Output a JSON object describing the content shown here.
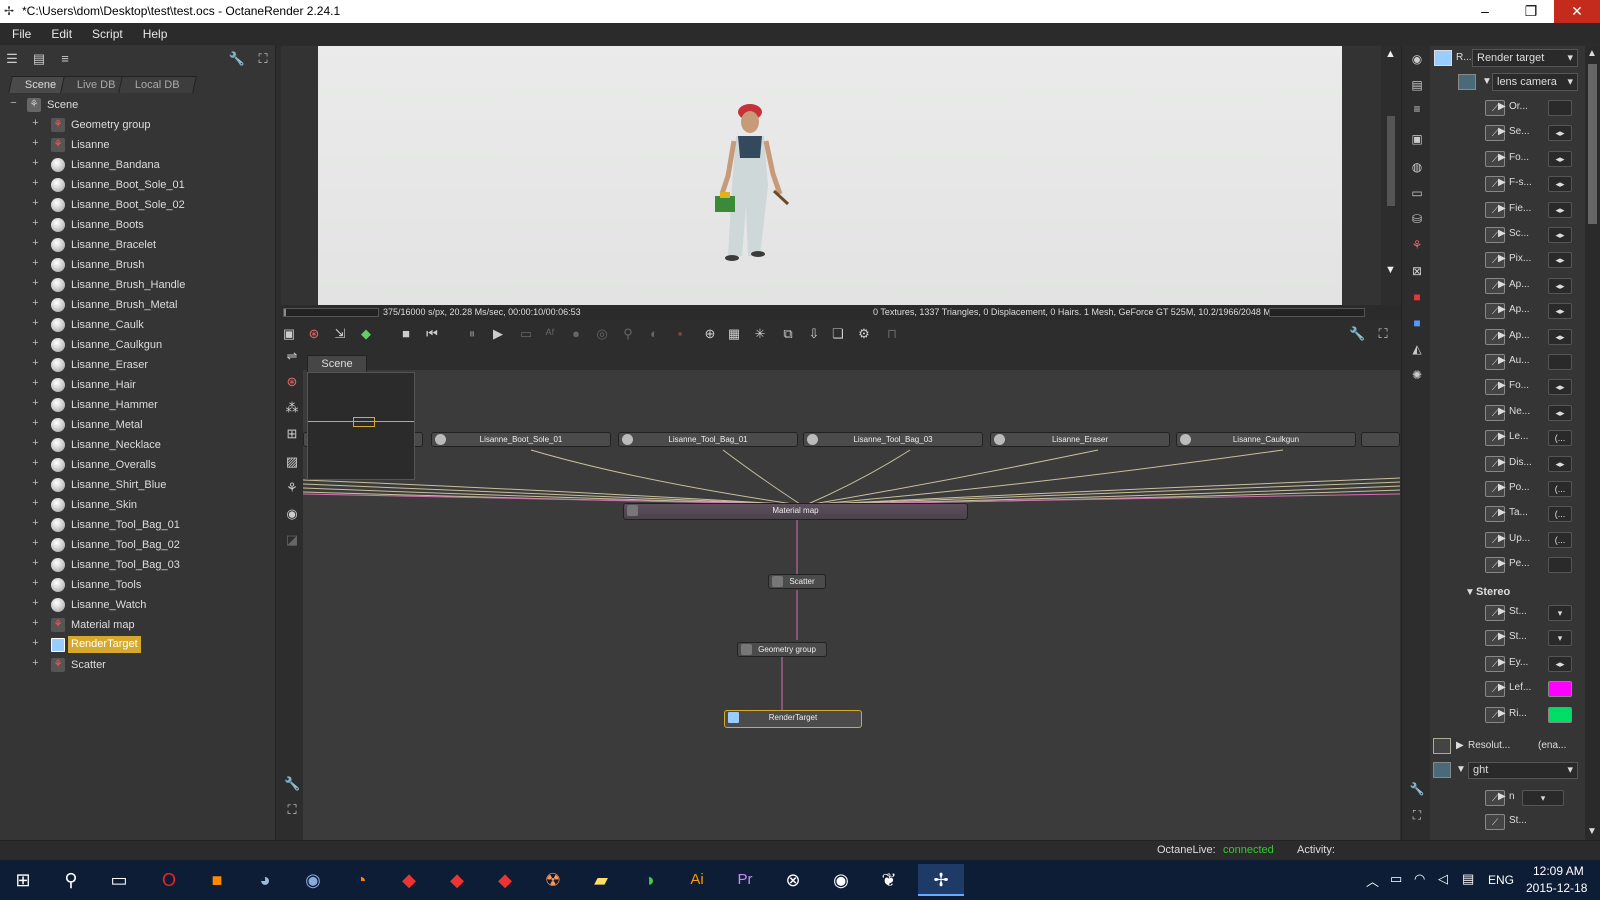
{
  "window": {
    "title": "*C:\\Users\\dom\\Desktop\\test\\test.ocs - OctaneRender 2.24.1"
  },
  "menu": [
    "File",
    "Edit",
    "Script",
    "Help"
  ],
  "left_panel": {
    "tabs": [
      "Scene",
      "Live DB",
      "Local DB"
    ],
    "root": "Scene",
    "items": [
      {
        "label": "Geometry group",
        "icon": "group-icon"
      },
      {
        "label": "Lisanne",
        "icon": "group-icon"
      },
      {
        "label": "Lisanne_Bandana",
        "icon": "material-ball-icon"
      },
      {
        "label": "Lisanne_Boot_Sole_01",
        "icon": "material-ball-icon"
      },
      {
        "label": "Lisanne_Boot_Sole_02",
        "icon": "material-ball-icon"
      },
      {
        "label": "Lisanne_Boots",
        "icon": "material-ball-icon"
      },
      {
        "label": "Lisanne_Bracelet",
        "icon": "material-ball-icon"
      },
      {
        "label": "Lisanne_Brush",
        "icon": "material-ball-icon"
      },
      {
        "label": "Lisanne_Brush_Handle",
        "icon": "material-ball-icon"
      },
      {
        "label": "Lisanne_Brush_Metal",
        "icon": "material-ball-icon"
      },
      {
        "label": "Lisanne_Caulk",
        "icon": "material-ball-icon"
      },
      {
        "label": "Lisanne_Caulkgun",
        "icon": "material-ball-icon"
      },
      {
        "label": "Lisanne_Eraser",
        "icon": "material-ball-icon"
      },
      {
        "label": "Lisanne_Hair",
        "icon": "material-ball-icon"
      },
      {
        "label": "Lisanne_Hammer",
        "icon": "material-ball-icon"
      },
      {
        "label": "Lisanne_Metal",
        "icon": "material-ball-icon"
      },
      {
        "label": "Lisanne_Necklace",
        "icon": "material-ball-icon"
      },
      {
        "label": "Lisanne_Overalls",
        "icon": "material-ball-icon"
      },
      {
        "label": "Lisanne_Shirt_Blue",
        "icon": "material-ball-icon"
      },
      {
        "label": "Lisanne_Skin",
        "icon": "material-ball-icon"
      },
      {
        "label": "Lisanne_Tool_Bag_01",
        "icon": "material-ball-icon"
      },
      {
        "label": "Lisanne_Tool_Bag_02",
        "icon": "material-ball-icon"
      },
      {
        "label": "Lisanne_Tool_Bag_03",
        "icon": "material-ball-icon"
      },
      {
        "label": "Lisanne_Tools",
        "icon": "material-ball-icon"
      },
      {
        "label": "Lisanne_Watch",
        "icon": "material-ball-icon"
      },
      {
        "label": "Material map",
        "icon": "group-icon"
      },
      {
        "label": "RenderTarget",
        "icon": "render-target-icon",
        "selected": true
      },
      {
        "label": "Scatter",
        "icon": "group-icon"
      }
    ]
  },
  "viewport": {
    "stats_left": "375/16000 s/px, 20.28 Ms/sec, 00:00:10/00:06:53",
    "stats_right": "0 Textures, 1337 Triangles, 0 Displacement, 0 Hairs. 1 Mesh, GeForce GT 525M, 10.2/1966/2048 MB"
  },
  "graph": {
    "tab": "Scene",
    "top_nodes": [
      "Lisanne_Boot_Sole_01",
      "Lisanne_Tool_Bag_01",
      "Lisanne_Tool_Bag_03",
      "Lisanne_Eraser",
      "Lisanne_Caulkgun"
    ],
    "material_map": "Material map",
    "scatter": "Scatter",
    "geometry_group": "Geometry group",
    "render_target": "RenderTarget"
  },
  "props": {
    "header": "R...",
    "header_select": "Render target",
    "camera_select": "lens camera",
    "rows": [
      {
        "label": "Or...",
        "ctl": ""
      },
      {
        "label": "Se...",
        "ctl": "◂▸"
      },
      {
        "label": "Fo...",
        "ctl": "◂▸"
      },
      {
        "label": "F-s...",
        "ctl": "◂▸"
      },
      {
        "label": "Fie...",
        "ctl": "◂▸"
      },
      {
        "label": "Sc...",
        "ctl": "◂▸"
      },
      {
        "label": "Pix...",
        "ctl": "◂▸"
      },
      {
        "label": "Ap...",
        "ctl": "◂▸"
      },
      {
        "label": "Ap...",
        "ctl": "◂▸"
      },
      {
        "label": "Ap...",
        "ctl": "◂▸"
      },
      {
        "label": "Au...",
        "ctl": ""
      },
      {
        "label": "Fo...",
        "ctl": "◂▸"
      },
      {
        "label": "Ne...",
        "ctl": "◂▸"
      },
      {
        "label": "Le...",
        "ctl": "(..."
      },
      {
        "label": "Dis...",
        "ctl": "◂▸"
      },
      {
        "label": "Po...",
        "ctl": "(..."
      },
      {
        "label": "Ta...",
        "ctl": "(..."
      },
      {
        "label": "Up...",
        "ctl": "(..."
      },
      {
        "label": "Pe...",
        "ctl": ""
      }
    ],
    "stereo_label": "Stereo",
    "stereo_rows": [
      {
        "label": "St...",
        "ctl": "▾"
      },
      {
        "label": "St...",
        "ctl": "▾"
      },
      {
        "label": "Ey...",
        "ctl": "◂▸"
      },
      {
        "label": "Lef...",
        "ctl": ""
      },
      {
        "label": "Ri...",
        "ctl": ""
      }
    ],
    "resolution_label": "Resolut...",
    "resolution_value": "(ena...",
    "light_select": "ght",
    "light_row": {
      "label": "n",
      "ctl": "▾"
    },
    "last_row": "St..."
  },
  "colors": {
    "left_eye": "#ff00ff",
    "right_eye": "#00dd66",
    "selection": "#d6a92d",
    "connected": "#2ecc2e"
  },
  "statusbar": {
    "label": "OctaneLive:",
    "status": "connected",
    "activity": "Activity:"
  },
  "taskbar": {
    "language": "ENG",
    "time": "12:09 AM",
    "date": "2015-12-18"
  }
}
